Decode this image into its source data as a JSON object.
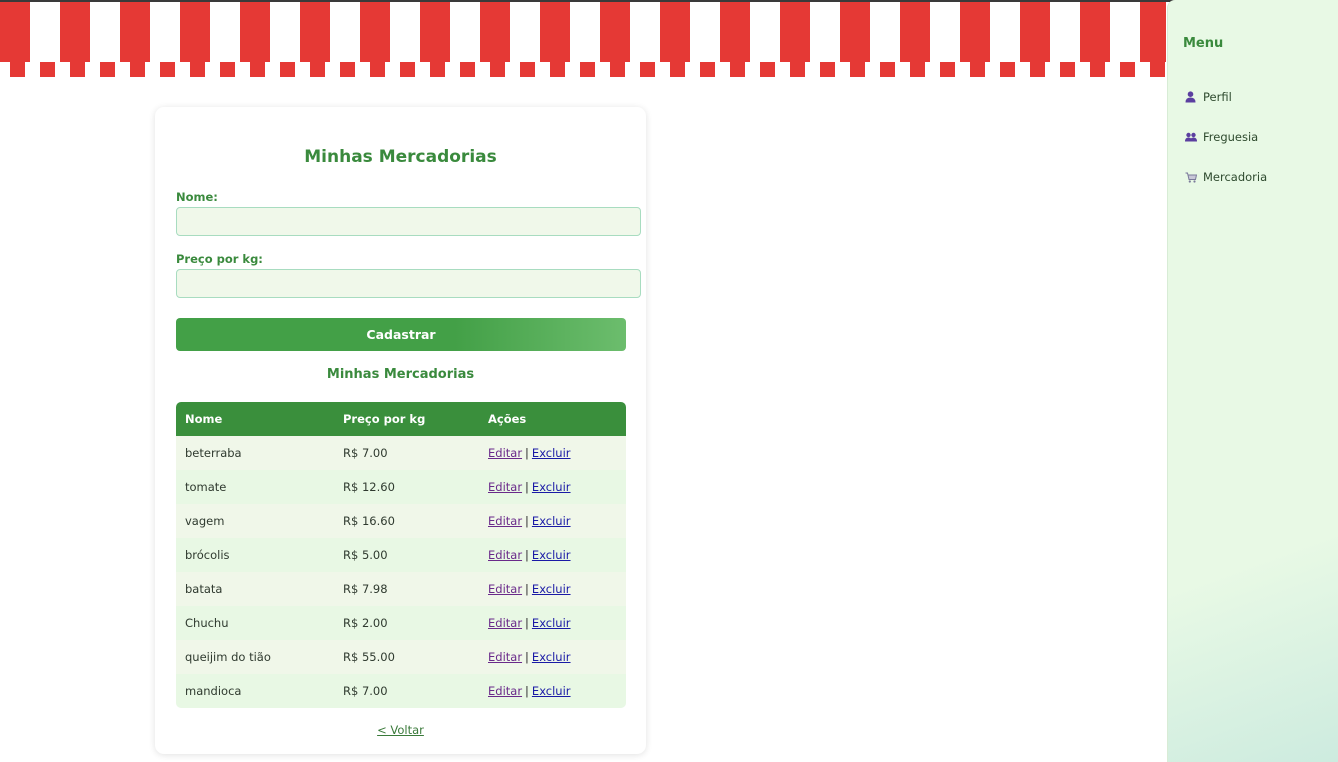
{
  "sidebar": {
    "title": "Menu",
    "items": [
      {
        "label": "Perfil",
        "icon": "user-icon"
      },
      {
        "label": "Freguesia",
        "icon": "users-icon"
      },
      {
        "label": "Mercadoria",
        "icon": "cart-icon"
      }
    ]
  },
  "form": {
    "title": "Minhas Mercadorias",
    "nome_label": "Nome:",
    "nome_value": "",
    "preco_label": "Preço por kg:",
    "preco_value": "",
    "submit_label": "Cadastrar"
  },
  "table": {
    "title": "Minhas Mercadorias",
    "headers": [
      "Nome",
      "Preço por kg",
      "Ações"
    ],
    "edit_label": "Editar",
    "delete_label": "Excluir",
    "separator": "|",
    "rows": [
      {
        "nome": "beterraba",
        "preco": "R$ 7.00"
      },
      {
        "nome": "tomate",
        "preco": "R$ 12.60"
      },
      {
        "nome": "vagem",
        "preco": "R$ 16.60"
      },
      {
        "nome": "brócolis",
        "preco": "R$ 5.00"
      },
      {
        "nome": "batata",
        "preco": "R$ 7.98"
      },
      {
        "nome": "Chuchu",
        "preco": "R$ 2.00"
      },
      {
        "nome": "queijim do tião",
        "preco": "R$ 55.00"
      },
      {
        "nome": "mandioca",
        "preco": "R$ 7.00"
      }
    ]
  },
  "back_label": "< Voltar",
  "colors": {
    "accent": "#3a8a3d",
    "awning_red": "#e53935",
    "header_green": "#3a8f3c"
  }
}
